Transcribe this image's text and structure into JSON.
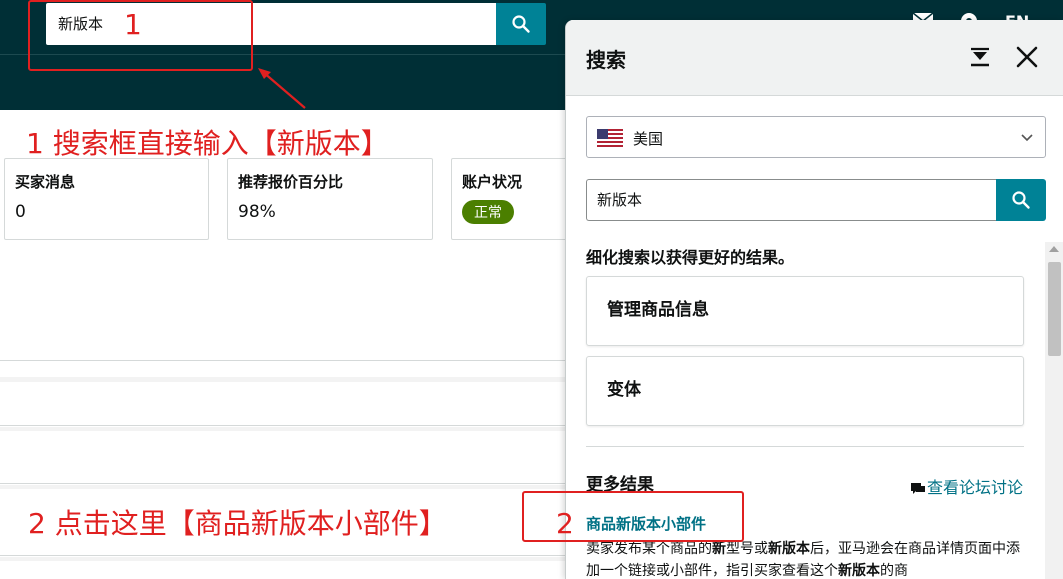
{
  "header": {
    "search_value": "新版本",
    "search_icon": "search-icon",
    "mail_icon": "mail-icon",
    "settings_icon": "gear-icon",
    "language_label": "EN",
    "background_color": "#002f36",
    "accent_color": "#008296"
  },
  "cards": [
    {
      "title": "买家消息",
      "value": "0"
    },
    {
      "title": "推荐报价百分比",
      "value": "98%"
    },
    {
      "title": "账户状况",
      "badge": "正常",
      "badge_color": "#4b7f00"
    }
  ],
  "annotations": {
    "box1_number": "1",
    "step1_text": "1 搜索框直接输入【新版本】",
    "box2_number": "2",
    "step2_text": "2 点击这里【商品新版本小部件】",
    "color": "#e02020"
  },
  "search_panel": {
    "title": "搜索",
    "dock_icon": "dock-bottom-icon",
    "close_icon": "close-icon",
    "country": {
      "flag_icon": "us-flag-icon",
      "selected": "美国"
    },
    "search_value": "新版本",
    "refine_hint": "细化搜索以获得更好的结果。",
    "refine_options": [
      "管理商品信息",
      "变体"
    ],
    "more_results_title": "更多结果",
    "forum_link": "查看论坛讨论",
    "result": {
      "title": "商品新版本小部件",
      "desc_1": "卖家发布某个商品的",
      "desc_2": "新",
      "desc_3": "型号或",
      "desc_4": "新版本",
      "desc_5": "后，亚马逊会在商品详情页面中添加一个链接或小部件，指引买家查看这个",
      "desc_6": "新版本",
      "desc_7": "的商"
    },
    "link_color": "#007185"
  }
}
